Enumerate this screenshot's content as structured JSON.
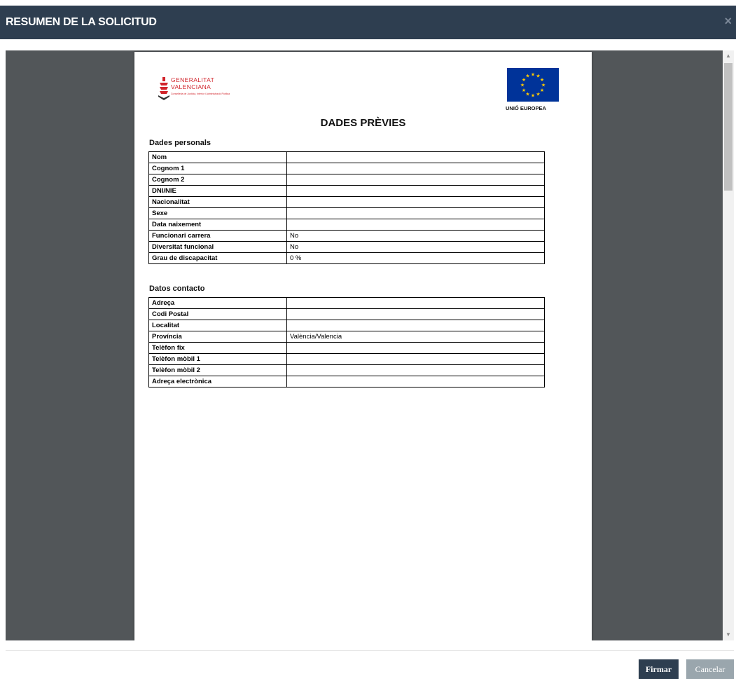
{
  "modal": {
    "title": "RESUMEN DE LA SOLICITUD",
    "close_glyph": "×"
  },
  "document": {
    "logo_left": {
      "name": "GENERALITAT VALENCIANA",
      "line1": "GENERALITAT",
      "line2": "VALENCIANA",
      "subline": "Conselleria de Justícia, Interior i Administració Pública"
    },
    "logo_right": {
      "label": "UNIÓ EUROPEA",
      "flag_color": "#003399"
    },
    "title": "DADES PRÈVIES",
    "sections": [
      {
        "title": "Dades personals",
        "rows": [
          {
            "label": "Nom",
            "value": ""
          },
          {
            "label": "Cognom 1",
            "value": ""
          },
          {
            "label": "Cognom 2",
            "value": ""
          },
          {
            "label": "DNI/NIE",
            "value": ""
          },
          {
            "label": "Nacionalitat",
            "value": ""
          },
          {
            "label": "Sexe",
            "value": ""
          },
          {
            "label": "Data naixement",
            "value": ""
          },
          {
            "label": "Funcionari carrera",
            "value": "No"
          },
          {
            "label": "Diversitat funcional",
            "value": "No"
          },
          {
            "label": "Grau de discapacitat",
            "value": "0 %"
          }
        ]
      },
      {
        "title": "Datos contacto",
        "rows": [
          {
            "label": "Adreça",
            "value": ""
          },
          {
            "label": "Codi Postal",
            "value": ""
          },
          {
            "label": "Localitat",
            "value": ""
          },
          {
            "label": "Província",
            "value": "València/Valencia"
          },
          {
            "label": "Telèfon fix",
            "value": ""
          },
          {
            "label": "Telèfon mòbil 1",
            "value": ""
          },
          {
            "label": "Telèfon mòbil 2",
            "value": ""
          },
          {
            "label": "Adreça electrònica",
            "value": ""
          }
        ]
      }
    ]
  },
  "footer": {
    "sign_label": "Firmar",
    "cancel_label": "Cancelar"
  },
  "colors": {
    "header_bg": "#2e3e50",
    "viewer_bg": "#525659",
    "sign_button": "#2e3e50",
    "cancel_button": "#9aa6ad",
    "brand_red": "#d1232a"
  }
}
